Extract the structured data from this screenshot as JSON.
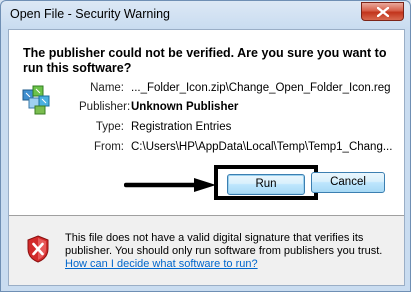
{
  "window": {
    "title": "Open File - Security Warning",
    "close_label": "Close"
  },
  "headline": "The publisher could not be verified.  Are you sure you want to run this software?",
  "details": {
    "name_label": "Name:",
    "name_value": "..._Folder_Icon.zip\\Change_Open_Folder_Icon.reg",
    "publisher_label": "Publisher:",
    "publisher_value": "Unknown Publisher",
    "type_label": "Type:",
    "type_value": "Registration Entries",
    "from_label": "From:",
    "from_value": "C:\\Users\\HP\\AppData\\Local\\Temp\\Temp1_Chang..."
  },
  "buttons": {
    "run_label": "Run",
    "cancel_label": "Cancel"
  },
  "footer": {
    "warning_text": "This file does not have a valid digital signature that verifies its publisher.  You should only run software from publishers you trust.",
    "help_link": "How can I decide what software to run?"
  },
  "icons": {
    "file": "registry-file-icon",
    "shield": "security-shield-icon",
    "annotation_arrow": "arrow-right-icon"
  },
  "colors": {
    "link": "#0066cc",
    "close_button": "#c8412a",
    "shield_red": "#cc2222",
    "highlight_box": "#000000"
  }
}
